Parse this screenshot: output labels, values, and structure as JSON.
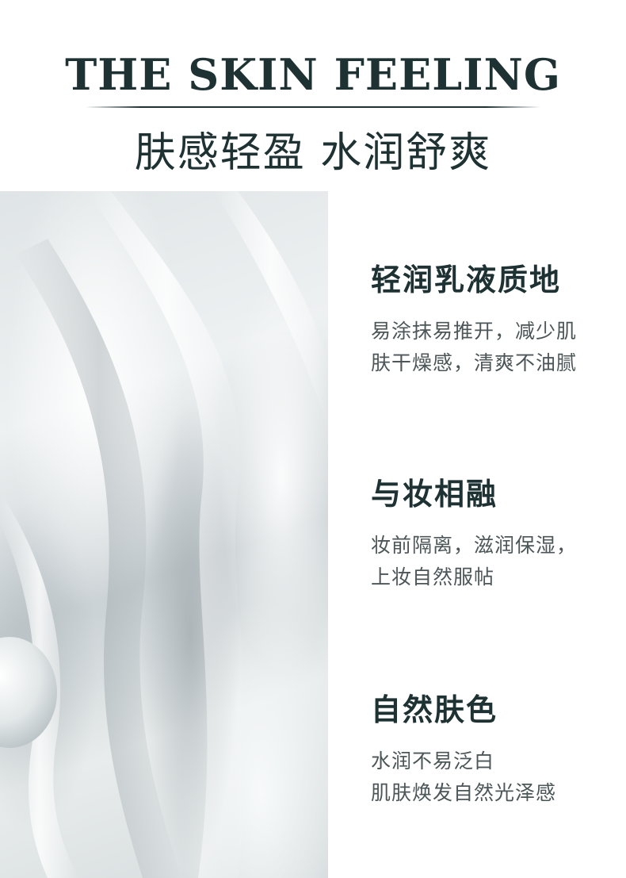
{
  "header": {
    "title_en": "THE SKIN FEELING",
    "title_zh": "肤感轻盈 水润舒爽"
  },
  "features": [
    {
      "title": "轻润乳液质地",
      "lines": [
        "易涂抹易推开，减少肌",
        "肤干燥感，清爽不油腻"
      ]
    },
    {
      "title": "与妆相融",
      "lines": [
        "妆前隔离，滋润保湿，",
        "上妆自然服帖"
      ]
    },
    {
      "title": "自然肤色",
      "lines": [
        "水润不易泛白",
        "肌肤焕发自然光泽感"
      ]
    }
  ],
  "colors": {
    "heading": "#1f3233",
    "body_text": "#4c5658",
    "background": "#ffffff"
  }
}
